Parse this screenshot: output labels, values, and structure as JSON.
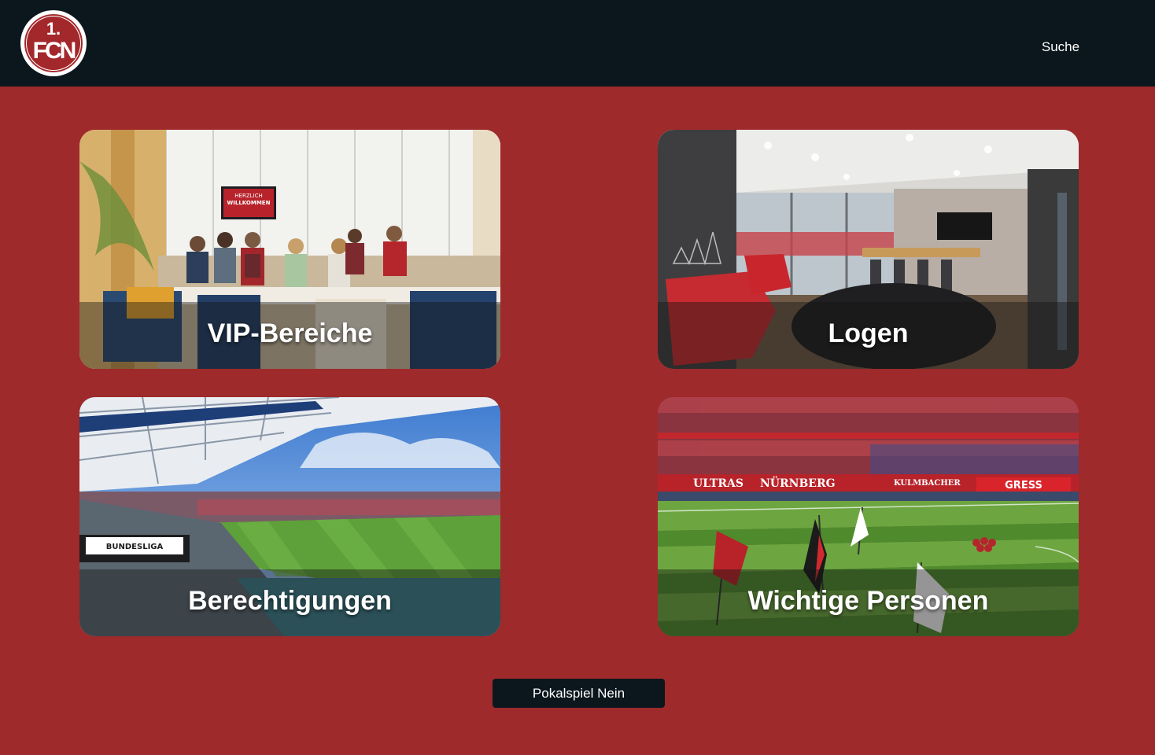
{
  "header": {
    "logo": {
      "top_text": "1.",
      "bottom_text": "FCN",
      "colors": {
        "ring": "#ffffff",
        "fill": "#a3282b"
      }
    },
    "search_label": "Suche"
  },
  "cards": [
    {
      "label": "VIP-Bereiche",
      "image": "vip-lounge-photo"
    },
    {
      "label": "Logen",
      "image": "private-box-photo"
    },
    {
      "label": "Berechtigungen",
      "image": "stadium-photo"
    },
    {
      "label": "Wichtige Personen",
      "image": "fans-pitch-photo"
    }
  ],
  "photo_signs": {
    "welcome": [
      "HERZLICH",
      "WILLKOMMEN"
    ],
    "bundesliga": "BUNDESLIGA",
    "banners": [
      "ULTRAS",
      "NÜRNBERG",
      "KULMBACHER",
      "GRESS"
    ]
  },
  "footer": {
    "pokal_button_label": "Pokalspiel Nein"
  },
  "theme": {
    "background": "#9e2a2b",
    "header_bg": "#0b171d",
    "button_bg": "#0b171d"
  }
}
